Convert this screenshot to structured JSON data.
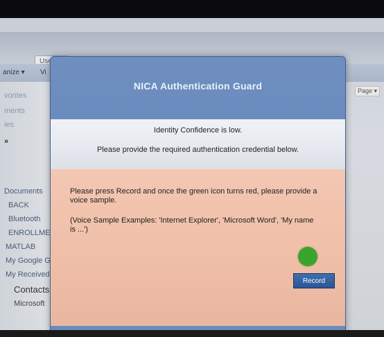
{
  "explorer": {
    "address_fragment": "Use",
    "cmdbar": {
      "organize": "anize ▾",
      "view": "Vi"
    },
    "page_button": "Page ▾",
    "nav": {
      "faded1": "vorites",
      "faded2": "ments",
      "faded3": "ies",
      "chevron": "»",
      "items": [
        "Documents",
        "BACK",
        "Bluetooth",
        "ENROLLMENT",
        "MATLAB",
        "My Google G",
        "My Received"
      ],
      "contacts": "Contacts",
      "microsoft": "Microsoft"
    }
  },
  "dialog": {
    "title": "NICA Authentication Guard",
    "info": {
      "line1": "Identity Confidence is low.",
      "line2": "Please provide the required authentication credential below."
    },
    "instruction": "Please press Record and once the green icon turns red, please provide a voice sample.",
    "examples": "(Voice Sample Examples: 'Internet Explorer', 'Microsoft Word', 'My name is ...')",
    "status_color": "#3aa52c",
    "record_label": "Record"
  }
}
